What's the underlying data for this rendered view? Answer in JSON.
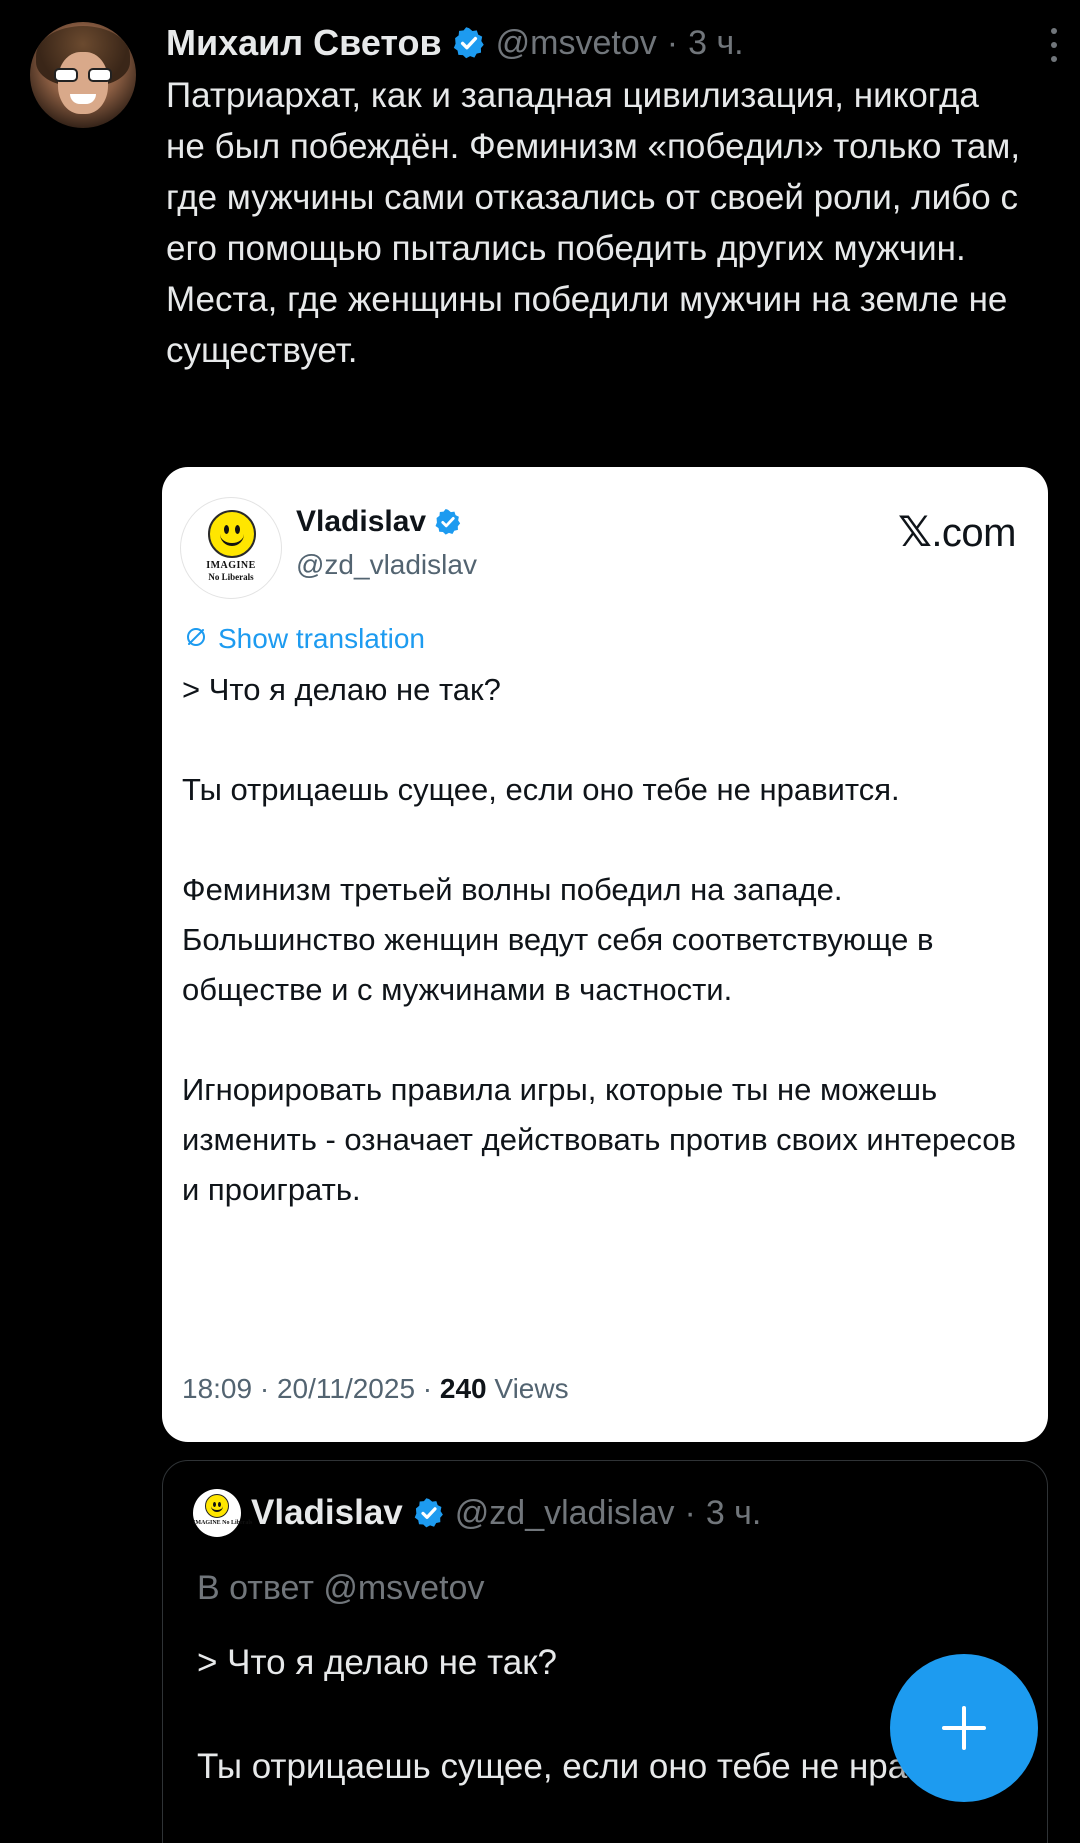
{
  "main_tweet": {
    "author_name": "Михаил Светов",
    "handle": "@msvetov",
    "separator": "·",
    "time": "3 ч.",
    "text": "Патриархат, как и западная цивилизация, никогда не был побеждён. Феминизм «победил» только там, где мужчины сами отказались от своей роли, либо с его помощью пытались победить других мужчин. Места, где женщины победили мужчин на земле не существует."
  },
  "quoted_card": {
    "author_name": "Vladislav",
    "handle": "@zd_vladislav",
    "avatar_caption_line1": "IMAGINE",
    "avatar_caption_line2": "No Liberals",
    "brand_x": "𝕏",
    "brand_suffix": ".com",
    "translation_label": "Show translation",
    "paragraphs": [
      "> Что я делаю не так?",
      "Ты отрицаешь сущее, если оно тебе не нравится.",
      "Феминизм третьей волны победил на западе. Большинство женщин ведут себя соответствующе в обществе и с мужчинами в частности.",
      "Игнорировать правила игры, которые ты не можешь изменить - означает действовать против своих интересов и проиграть."
    ],
    "timestamp": "18:09 · 20/11/2025 · ",
    "views_count": "240",
    "views_label": "Views"
  },
  "reply": {
    "author_name": "Vladislav",
    "handle": "@zd_vladislav",
    "separator": "·",
    "time": "3 ч.",
    "avatar_caption": "IMAGINE No Liberals",
    "reply_to": "В ответ @msvetov",
    "paragraphs": [
      "> Что я делаю не так?",
      "Ты отрицаешь сущее, если оно тебе не нравится."
    ]
  },
  "fab": {
    "icon": "plus-icon"
  },
  "colors": {
    "background": "#000000",
    "accent": "#1d9bf0",
    "secondary_text": "#71767b",
    "primary_text": "#e7e9ea"
  }
}
